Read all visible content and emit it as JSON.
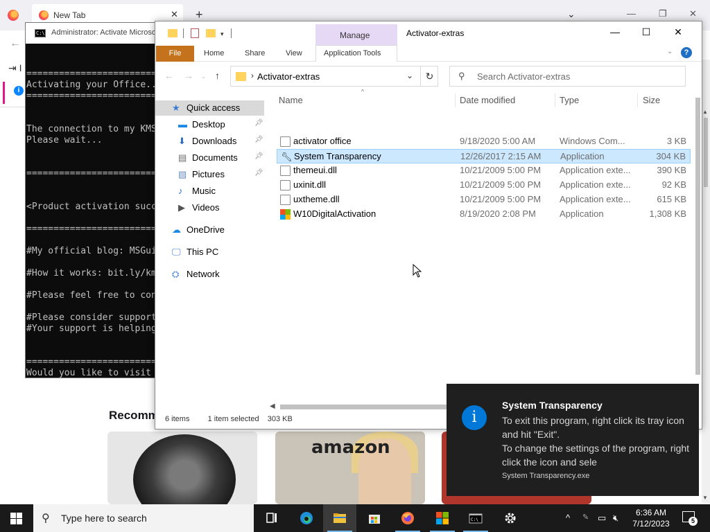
{
  "firefox": {
    "tab_title": "New Tab",
    "side_partial": "I",
    "recommended_partial": "Recomm",
    "card2_brand": "amazon"
  },
  "cmd": {
    "title": "Administrator:  Activate Microso",
    "lines": [
      "",
      "",
      "========================================",
      "Activating your Office...",
      "========================================",
      "",
      "",
      "The connection to my KMS server failed!",
      "Please wait...",
      "",
      "",
      "========================================",
      "",
      "",
      "<Product activation successful>",
      "",
      "========================================",
      "",
      "#My official blog: MSGuides.com",
      "",
      "#How it works: bit.ly/kms-server",
      "",
      "#Please feel free to contact me",
      "",
      "#Please consider supporting this project",
      "#Your support is helping me",
      "",
      "",
      "========================================",
      "Would you like to visit my blog [Y,N]?"
    ]
  },
  "explorer": {
    "title": "Activator-extras",
    "manage_label": "Manage",
    "ribbon_tabs": [
      "Home",
      "Share",
      "View"
    ],
    "file_tab": "File",
    "app_tools": "Application Tools",
    "address": "Activator-extras",
    "search_placeholder": "Search Activator-extras",
    "nav": [
      {
        "label": "Quick access",
        "icon": "star-icon"
      },
      {
        "label": "Desktop",
        "icon": "desktop-icon"
      },
      {
        "label": "Downloads",
        "icon": "download-icon"
      },
      {
        "label": "Documents",
        "icon": "documents-icon"
      },
      {
        "label": "Pictures",
        "icon": "pictures-icon"
      },
      {
        "label": "Music",
        "icon": "music-icon"
      },
      {
        "label": "Videos",
        "icon": "videos-icon"
      },
      {
        "label": "OneDrive",
        "icon": "cloud-icon"
      },
      {
        "label": "This PC",
        "icon": "computer-icon"
      },
      {
        "label": "Network",
        "icon": "network-icon"
      }
    ],
    "columns": [
      "Name",
      "Date modified",
      "Type",
      "Size"
    ],
    "files": [
      {
        "name": "activator office",
        "date": "9/18/2020 5:00 AM",
        "type": "Windows Com...",
        "size": "3 KB",
        "icon": "document-icon"
      },
      {
        "name": "System Transparency",
        "date": "12/26/2017 2:15 AM",
        "type": "Application",
        "size": "304 KB",
        "icon": "wrench-icon"
      },
      {
        "name": "themeui.dll",
        "date": "10/21/2009 5:00 PM",
        "type": "Application exte...",
        "size": "390 KB",
        "icon": "dll-icon"
      },
      {
        "name": "uxinit.dll",
        "date": "10/21/2009 5:00 PM",
        "type": "Application exte...",
        "size": "92 KB",
        "icon": "dll-icon"
      },
      {
        "name": "uxtheme.dll",
        "date": "10/21/2009 5:00 PM",
        "type": "Application exte...",
        "size": "615 KB",
        "icon": "dll-icon"
      },
      {
        "name": "W10DigitalActivation",
        "date": "8/19/2020 2:08 PM",
        "type": "Application",
        "size": "1,308 KB",
        "icon": "windows-logo-icon"
      }
    ],
    "status": {
      "items": "6 items",
      "selected": "1 item selected",
      "size": "303 KB"
    }
  },
  "toast": {
    "title": "System Transparency",
    "body": "To exit this program, right click its tray icon and hit \"Exit\".\nTo change the settings of the program, right click the icon and sele",
    "app": "System Transparency.exe"
  },
  "taskbar": {
    "search_placeholder": "Type here to search",
    "time": "6:36 AM",
    "date": "7/12/2023",
    "notification_count": "5"
  }
}
